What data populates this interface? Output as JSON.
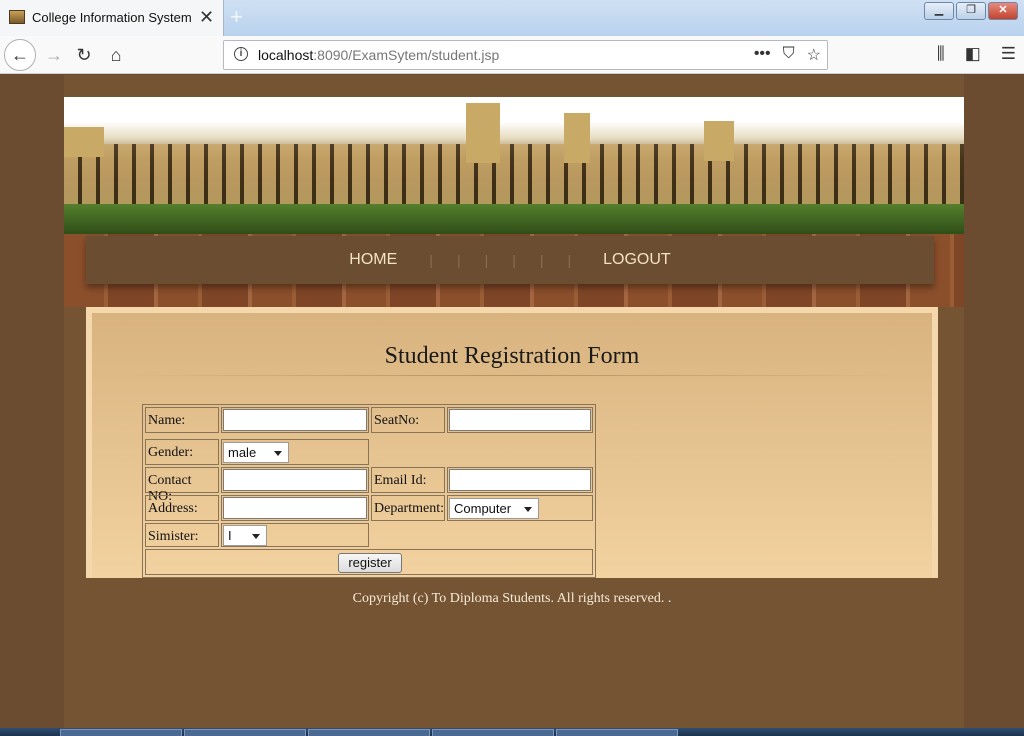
{
  "browser": {
    "tab_title": "College Information System",
    "url_host": "localhost",
    "url_rest": ":8090/ExamSytem/student.jsp"
  },
  "nav": {
    "items": [
      "HOME",
      "LOGOUT"
    ],
    "separators": [
      "|",
      "|",
      "|",
      "|",
      "|",
      "|"
    ]
  },
  "form": {
    "title": "Student Registration Form",
    "labels": {
      "name": "Name:",
      "seatno": "SeatNo:",
      "gender": "Gender:",
      "contact": "Contact NO:",
      "email": "Email Id:",
      "address": "Address:",
      "department": "Department:",
      "semester": "Simister:"
    },
    "values": {
      "name": "",
      "seatno": "",
      "contact": "",
      "email": "",
      "address": ""
    },
    "selects": {
      "gender": "male",
      "department": "Computer",
      "semester": "I"
    },
    "submit_label": "register"
  },
  "footer": {
    "copyright": "Copyright (c) To Diploma Students. All rights reserved. ."
  }
}
